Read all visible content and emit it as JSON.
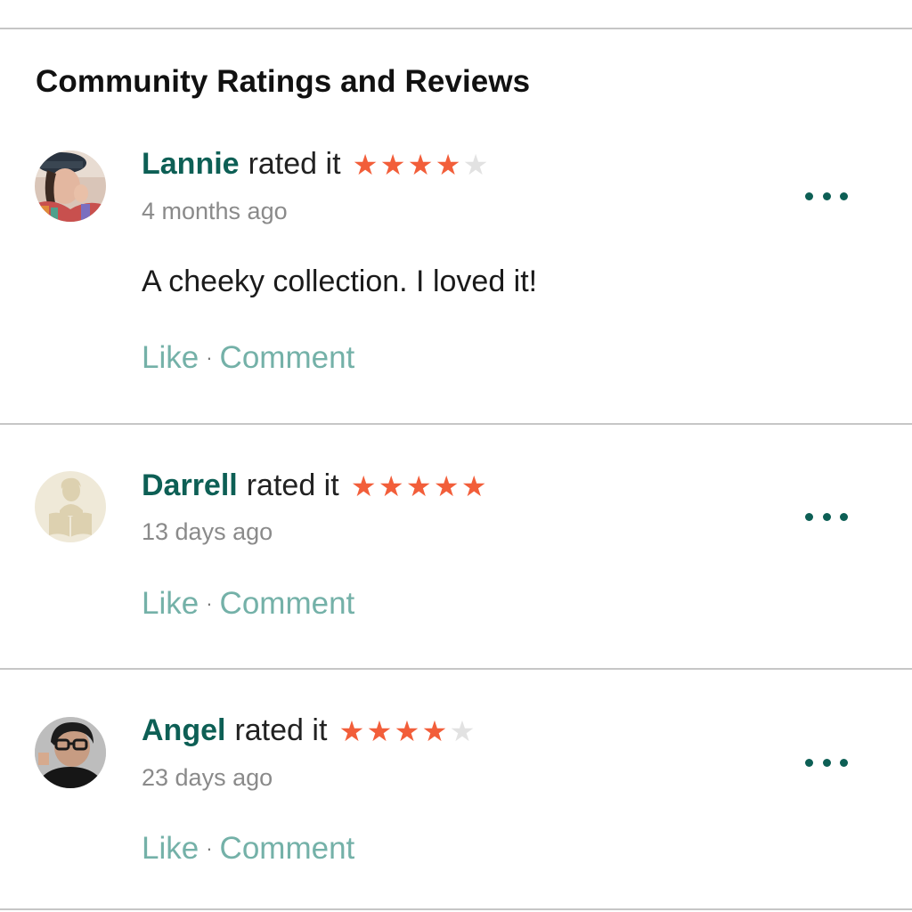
{
  "section": {
    "title": "Community Ratings and Reviews"
  },
  "common": {
    "rated_it": "rated it",
    "like_label": "Like",
    "separator": "·",
    "comment_label": "Comment"
  },
  "colors": {
    "brand_green": "#0d5f55",
    "star_on": "#f25e3a",
    "star_off": "#e2e2e2",
    "action_teal": "#74b1a8"
  },
  "reviews": [
    {
      "user": "Lannie",
      "avatar_icon": "user-photo-avatar",
      "rating": 4,
      "max_rating": 5,
      "time": "4 months ago",
      "text": "A cheeky collection. I loved it!"
    },
    {
      "user": "Darrell",
      "avatar_icon": "default-reader-avatar-icon",
      "rating": 5,
      "max_rating": 5,
      "time": "13 days ago",
      "text": ""
    },
    {
      "user": "Angel",
      "avatar_icon": "user-photo-avatar",
      "rating": 4,
      "max_rating": 5,
      "time": "23 days ago",
      "text": ""
    }
  ]
}
